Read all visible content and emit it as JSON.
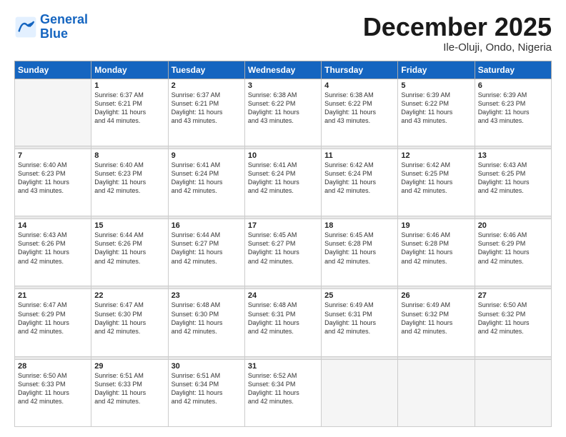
{
  "header": {
    "logo_general": "General",
    "logo_blue": "Blue",
    "title": "December 2025",
    "subtitle": "Ile-Oluji, Ondo, Nigeria"
  },
  "days_of_week": [
    "Sunday",
    "Monday",
    "Tuesday",
    "Wednesday",
    "Thursday",
    "Friday",
    "Saturday"
  ],
  "weeks": [
    [
      {
        "day": "",
        "info": ""
      },
      {
        "day": "1",
        "info": "Sunrise: 6:37 AM\nSunset: 6:21 PM\nDaylight: 11 hours\nand 44 minutes."
      },
      {
        "day": "2",
        "info": "Sunrise: 6:37 AM\nSunset: 6:21 PM\nDaylight: 11 hours\nand 43 minutes."
      },
      {
        "day": "3",
        "info": "Sunrise: 6:38 AM\nSunset: 6:22 PM\nDaylight: 11 hours\nand 43 minutes."
      },
      {
        "day": "4",
        "info": "Sunrise: 6:38 AM\nSunset: 6:22 PM\nDaylight: 11 hours\nand 43 minutes."
      },
      {
        "day": "5",
        "info": "Sunrise: 6:39 AM\nSunset: 6:22 PM\nDaylight: 11 hours\nand 43 minutes."
      },
      {
        "day": "6",
        "info": "Sunrise: 6:39 AM\nSunset: 6:23 PM\nDaylight: 11 hours\nand 43 minutes."
      }
    ],
    [
      {
        "day": "7",
        "info": "Sunrise: 6:40 AM\nSunset: 6:23 PM\nDaylight: 11 hours\nand 43 minutes."
      },
      {
        "day": "8",
        "info": "Sunrise: 6:40 AM\nSunset: 6:23 PM\nDaylight: 11 hours\nand 42 minutes."
      },
      {
        "day": "9",
        "info": "Sunrise: 6:41 AM\nSunset: 6:24 PM\nDaylight: 11 hours\nand 42 minutes."
      },
      {
        "day": "10",
        "info": "Sunrise: 6:41 AM\nSunset: 6:24 PM\nDaylight: 11 hours\nand 42 minutes."
      },
      {
        "day": "11",
        "info": "Sunrise: 6:42 AM\nSunset: 6:24 PM\nDaylight: 11 hours\nand 42 minutes."
      },
      {
        "day": "12",
        "info": "Sunrise: 6:42 AM\nSunset: 6:25 PM\nDaylight: 11 hours\nand 42 minutes."
      },
      {
        "day": "13",
        "info": "Sunrise: 6:43 AM\nSunset: 6:25 PM\nDaylight: 11 hours\nand 42 minutes."
      }
    ],
    [
      {
        "day": "14",
        "info": "Sunrise: 6:43 AM\nSunset: 6:26 PM\nDaylight: 11 hours\nand 42 minutes."
      },
      {
        "day": "15",
        "info": "Sunrise: 6:44 AM\nSunset: 6:26 PM\nDaylight: 11 hours\nand 42 minutes."
      },
      {
        "day": "16",
        "info": "Sunrise: 6:44 AM\nSunset: 6:27 PM\nDaylight: 11 hours\nand 42 minutes."
      },
      {
        "day": "17",
        "info": "Sunrise: 6:45 AM\nSunset: 6:27 PM\nDaylight: 11 hours\nand 42 minutes."
      },
      {
        "day": "18",
        "info": "Sunrise: 6:45 AM\nSunset: 6:28 PM\nDaylight: 11 hours\nand 42 minutes."
      },
      {
        "day": "19",
        "info": "Sunrise: 6:46 AM\nSunset: 6:28 PM\nDaylight: 11 hours\nand 42 minutes."
      },
      {
        "day": "20",
        "info": "Sunrise: 6:46 AM\nSunset: 6:29 PM\nDaylight: 11 hours\nand 42 minutes."
      }
    ],
    [
      {
        "day": "21",
        "info": "Sunrise: 6:47 AM\nSunset: 6:29 PM\nDaylight: 11 hours\nand 42 minutes."
      },
      {
        "day": "22",
        "info": "Sunrise: 6:47 AM\nSunset: 6:30 PM\nDaylight: 11 hours\nand 42 minutes."
      },
      {
        "day": "23",
        "info": "Sunrise: 6:48 AM\nSunset: 6:30 PM\nDaylight: 11 hours\nand 42 minutes."
      },
      {
        "day": "24",
        "info": "Sunrise: 6:48 AM\nSunset: 6:31 PM\nDaylight: 11 hours\nand 42 minutes."
      },
      {
        "day": "25",
        "info": "Sunrise: 6:49 AM\nSunset: 6:31 PM\nDaylight: 11 hours\nand 42 minutes."
      },
      {
        "day": "26",
        "info": "Sunrise: 6:49 AM\nSunset: 6:32 PM\nDaylight: 11 hours\nand 42 minutes."
      },
      {
        "day": "27",
        "info": "Sunrise: 6:50 AM\nSunset: 6:32 PM\nDaylight: 11 hours\nand 42 minutes."
      }
    ],
    [
      {
        "day": "28",
        "info": "Sunrise: 6:50 AM\nSunset: 6:33 PM\nDaylight: 11 hours\nand 42 minutes."
      },
      {
        "day": "29",
        "info": "Sunrise: 6:51 AM\nSunset: 6:33 PM\nDaylight: 11 hours\nand 42 minutes."
      },
      {
        "day": "30",
        "info": "Sunrise: 6:51 AM\nSunset: 6:34 PM\nDaylight: 11 hours\nand 42 minutes."
      },
      {
        "day": "31",
        "info": "Sunrise: 6:52 AM\nSunset: 6:34 PM\nDaylight: 11 hours\nand 42 minutes."
      },
      {
        "day": "",
        "info": ""
      },
      {
        "day": "",
        "info": ""
      },
      {
        "day": "",
        "info": ""
      }
    ]
  ]
}
